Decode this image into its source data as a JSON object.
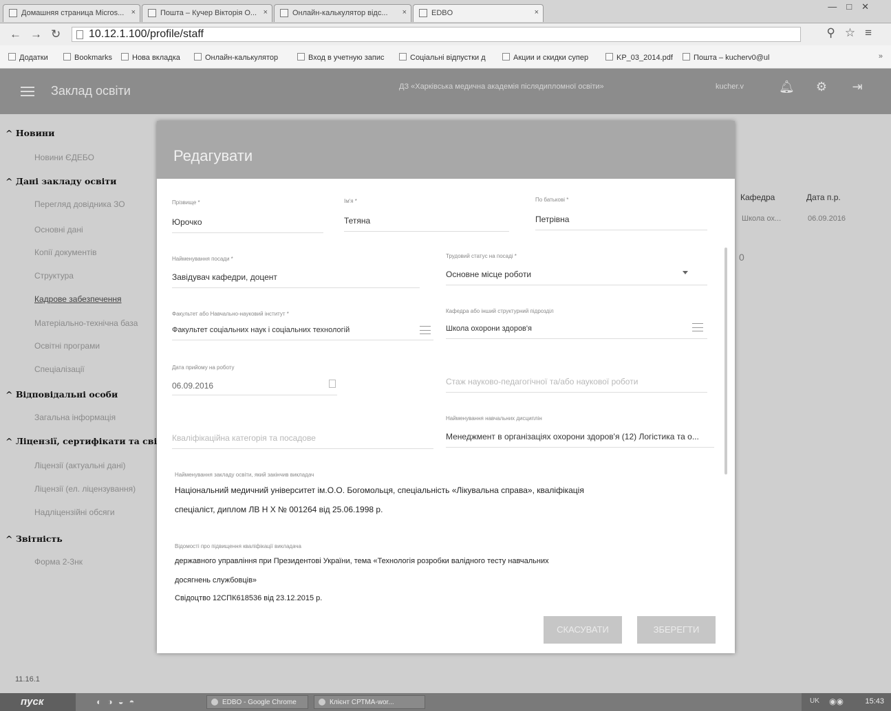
{
  "browser": {
    "tabs": [
      {
        "label": "Домашняя страница Micros..."
      },
      {
        "label": "Пошта – Кучер Вікторія О..."
      },
      {
        "label": "Онлайн-калькулятор відс..."
      },
      {
        "label": "EDBO"
      }
    ],
    "url": "10.12.1.100/profile/staff",
    "bookmarks": [
      {
        "label": "Додатки"
      },
      {
        "label": "Bookmarks"
      },
      {
        "label": "Нова вкладка"
      },
      {
        "label": "Онлайн-калькулятор"
      },
      {
        "label": "Вход в учетную запис"
      },
      {
        "label": "Соціальні відпустки д"
      },
      {
        "label": "Акции и скидки супер"
      },
      {
        "label": "KP_03_2014.pdf"
      },
      {
        "label": "Пошта – kucherv0@ul"
      }
    ],
    "bookmarks_more": "»"
  },
  "app": {
    "title": "Заклад освіти",
    "center_text": "ДЗ «Харківська медична академія післядипломної освіти»",
    "user_text": "kucher.v"
  },
  "sidebar": {
    "sections": [
      {
        "label": "^ Новини"
      },
      {
        "label": "^ Дані закладу освіти"
      },
      {
        "label": "^ Відповідальні особи"
      },
      {
        "label": "^ Ліцензії, сертифікати та свід"
      },
      {
        "label": "^ Звітність"
      }
    ],
    "items": [
      {
        "label": "Новини ЄДЕБО"
      },
      {
        "label": "Перегляд довідника ЗО"
      },
      {
        "label": "Основні дані"
      },
      {
        "label": "Копії документів"
      },
      {
        "label": "Структура"
      },
      {
        "label": "Кадрове забезпечення"
      },
      {
        "label": "Матеріально-технічна база"
      },
      {
        "label": "Освітні програми"
      },
      {
        "label": "Спеціалізації"
      },
      {
        "label": "Загальна інформація"
      },
      {
        "label": "Ліцензії (актуальні дані)"
      },
      {
        "label": "Ліцензії (ел. ліцензування)"
      },
      {
        "label": "Надліцензійні обсяги"
      },
      {
        "label": "Форма 2-3нк"
      }
    ]
  },
  "background_table": {
    "headers": [
      "Кафедра",
      "Дата п.р."
    ],
    "row": [
      "Школа ох...",
      "06.09.2016"
    ],
    "page_num": "0"
  },
  "modal": {
    "title": "Редагувати",
    "fields": {
      "surname": {
        "label": "Прізвище *",
        "value": "Юрочко"
      },
      "name": {
        "label": "Ім'я *",
        "value": "Тетяна"
      },
      "patronymic": {
        "label": "По батькові *",
        "value": "Петрівна"
      },
      "position": {
        "label": "Найменування посади *",
        "value": "Завідувач кафедри, доцент"
      },
      "employment": {
        "label": "Трудовий статус на посаді *",
        "value": "Основне місце роботи"
      },
      "faculty": {
        "label": "Факультет або Навчально-науковий інститут *",
        "value": "Факультет соціальних наук і соціальних технологій"
      },
      "department": {
        "label": "Кафедра або інший структурний підрозділ",
        "value": "Школа охорони здоров'я"
      },
      "hire_date": {
        "label": "Дата прийому на роботу",
        "value": "06.09.2016"
      },
      "workload": {
        "placeholder": "Стаж науково-педагогічної та/або наукової роботи"
      },
      "qualification_category": {
        "placeholder": "Кваліфікаційна категорія та посадове"
      },
      "disciplines": {
        "label": "Найменування навчальних дисциплін",
        "value": "Менеджмент в організаціях охорони здоров'я (12) Логістика та о..."
      },
      "education": {
        "label": "Найменування закладу освіти, який закінчив викладач",
        "lines": [
          "Національний медичний університет ім.О.О. Богомольця, спеціальність «Лікувальна справа», кваліфікація",
          "спеціаліст, диплом ЛВ Н Х № 001264 від 25.06.1998 р."
        ]
      },
      "qual_upgrade": {
        "label": "Відомості про підвищення кваліфікації викладача",
        "lines": [
          "державного управління при Президентові України, тема «Технологія розробки валідного тесту навчальних",
          "досягнень службовців»",
          "Свідоцтво 12СПК618536 від 23.12.2015 р."
        ]
      }
    },
    "buttons": {
      "cancel": "СКАСУВАТИ",
      "save": "ЗБЕРЕГТИ"
    }
  },
  "footer": {
    "version": "11.16.1"
  },
  "taskbar": {
    "start": "пуск",
    "tasks": [
      {
        "label": "EDBO - Google Chrome"
      },
      {
        "label": "Клієнт СРТМА-wor..."
      }
    ],
    "tray_lang": "UK",
    "clock": "15:43"
  }
}
